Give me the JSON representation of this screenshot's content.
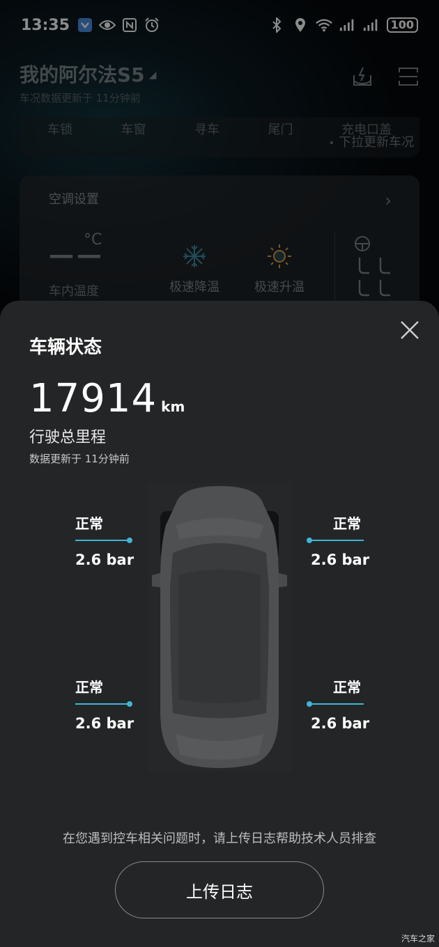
{
  "status_bar": {
    "time": "13:35",
    "battery": "100",
    "left_icons": [
      "app-notification-icon",
      "eye-icon",
      "nfc-icon",
      "alarm-icon"
    ],
    "right_icons": [
      "bluetooth-icon",
      "location-icon",
      "wifi-icon",
      "signal-icon",
      "signal-icon"
    ]
  },
  "background_app": {
    "car_name": "我的阿尔法S5",
    "update_text": "车况数据更新于 11分钟前",
    "controls": [
      "车锁",
      "车窗",
      "寻车",
      "尾门",
      "充电口盖"
    ],
    "pull_hint": "下拉更新车况",
    "ac": {
      "title": "空调设置",
      "temp_value": "——",
      "temp_unit": "°C",
      "temp_label": "车内温度",
      "cool_label": "极速降温",
      "heat_label": "极速升温"
    }
  },
  "sheet": {
    "title": "车辆状态",
    "mileage": "17914",
    "mileage_unit": "km",
    "mileage_label": "行驶总里程",
    "update_text": "数据更新于 11分钟前",
    "tires": {
      "front_left": {
        "status": "正常",
        "pressure": "2.6 bar"
      },
      "front_right": {
        "status": "正常",
        "pressure": "2.6 bar"
      },
      "rear_left": {
        "status": "正常",
        "pressure": "2.6 bar"
      },
      "rear_right": {
        "status": "正常",
        "pressure": "2.6 bar"
      }
    },
    "help_text": "在您遇到控车相关问题时，请上传日志帮助技术人员排查",
    "upload_button": "上传日志"
  },
  "watermark": "汽车之家",
  "colors": {
    "accent": "#3fb6d6",
    "sheet_bg": "#242527",
    "cool_icon": "#3a8aa0",
    "heat_icon": "#e0a040"
  }
}
